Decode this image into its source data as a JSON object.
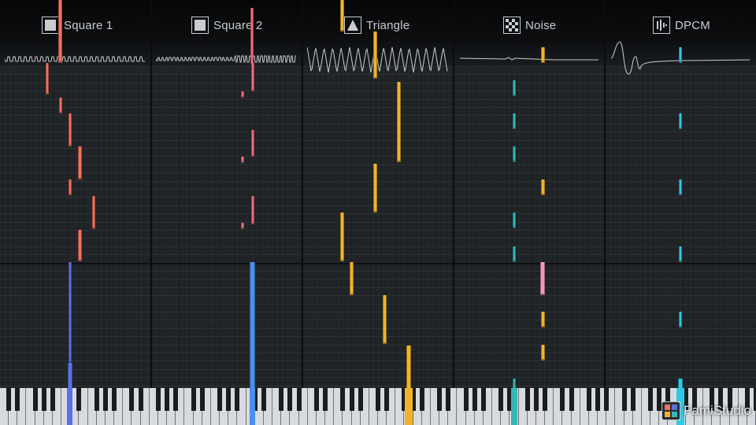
{
  "app": {
    "brand": "FamiStudio"
  },
  "channels": [
    {
      "name": "Square 1",
      "icon": "square-wave-icon",
      "color": "#f3705d"
    },
    {
      "name": "Square 2",
      "icon": "square-wave-icon",
      "color": "#f06b7c"
    },
    {
      "name": "Triangle",
      "icon": "triangle-wave-icon",
      "color": "#f0b42c"
    },
    {
      "name": "Noise",
      "icon": "noise-icon",
      "color": "#35b6b8"
    },
    {
      "name": "DPCM",
      "icon": "dpcm-icon",
      "color": "#2fc8e6"
    }
  ],
  "colors": {
    "blue_note": "#5b72e0",
    "blue_note_2": "#4a8fe8",
    "pink_note": "#f19ab8",
    "background": "#1f2326",
    "keyboard": "#d7dbe0"
  }
}
